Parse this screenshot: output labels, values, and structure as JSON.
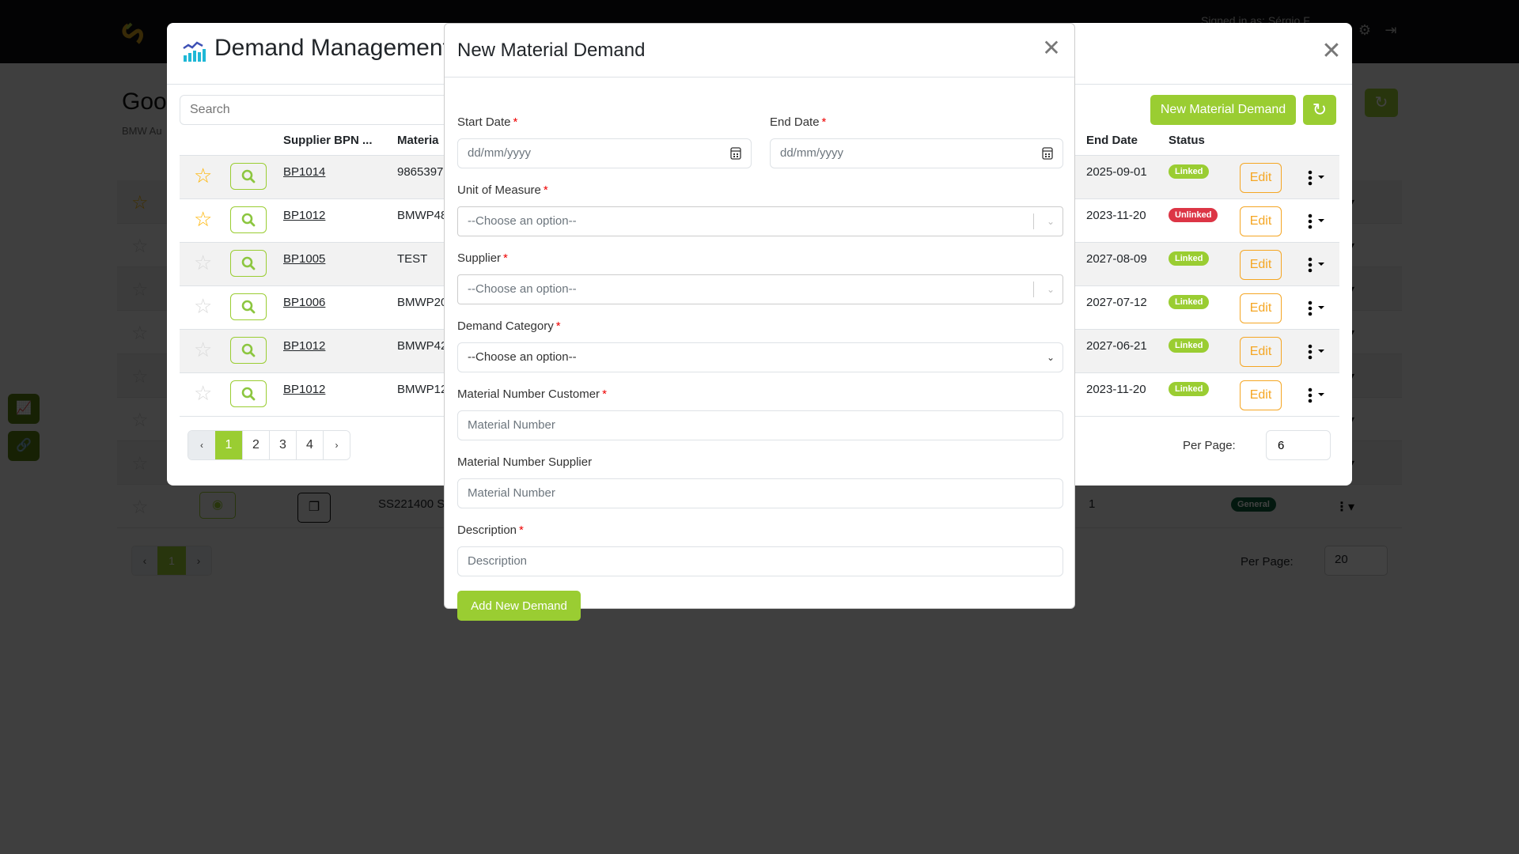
{
  "topbar": {
    "signed_in": "Signed in as: Sérgio F",
    "icons": [
      "logo-icon",
      "gear-icon",
      "logout-icon"
    ]
  },
  "background_page": {
    "title": "Goo",
    "subtitle": "BMW Au",
    "last_row": {
      "material": "SS221400 S",
      "quantity": "1",
      "category": "General"
    },
    "pagination": {
      "prev": "‹",
      "current": "1",
      "next": "›"
    },
    "per_page_label": "Per Page:",
    "per_page_value": "20"
  },
  "demand_modal": {
    "title": "Demand Management",
    "search_placeholder": "Search",
    "new_button": "New Material Demand",
    "columns": {
      "supplier_bpn": "Supplier BPN ...",
      "material": "Materia",
      "end_date": "End Date",
      "status": "Status"
    },
    "rows": [
      {
        "starred": true,
        "bpn": "BP1014",
        "material": "9865397",
        "end_date": "2025-09-01",
        "status": "Linked",
        "edit": "Edit"
      },
      {
        "starred": true,
        "bpn": "BP1012",
        "material": "BMWP48",
        "end_date": "2023-11-20",
        "status": "Unlinked",
        "edit": "Edit"
      },
      {
        "starred": false,
        "bpn": "BP1005",
        "material": "TEST",
        "end_date": "2027-08-09",
        "status": "Linked",
        "edit": "Edit"
      },
      {
        "starred": false,
        "bpn": "BP1006",
        "material": "BMWP20",
        "end_date": "2027-07-12",
        "status": "Linked",
        "edit": "Edit"
      },
      {
        "starred": false,
        "bpn": "BP1012",
        "material": "BMWP42",
        "end_date": "2027-06-21",
        "status": "Linked",
        "edit": "Edit"
      },
      {
        "starred": false,
        "bpn": "BP1012",
        "material": "BMWP12",
        "end_date": "2023-11-20",
        "status": "Linked",
        "edit": "Edit"
      }
    ],
    "pagination": {
      "prev": "‹",
      "pages": [
        "1",
        "2",
        "3",
        "4"
      ],
      "current": "1",
      "next": "›"
    },
    "per_page_label": "Per Page:",
    "per_page_value": "6",
    "colors": {
      "accent": "#9acd32",
      "linked": "#9acd32",
      "unlinked": "#dc3545",
      "edit": "#f5a623",
      "star_on": "#ffb400"
    }
  },
  "new_demand_modal": {
    "title": "New Material Demand",
    "fields": {
      "start_date": {
        "label": "Start Date",
        "required": "*",
        "placeholder": "dd/mm/yyyy"
      },
      "end_date": {
        "label": "End Date",
        "required": "*",
        "placeholder": "dd/mm/yyyy"
      },
      "unit_of_measure": {
        "label": "Unit of Measure",
        "required": "*",
        "value": "--Choose an option--"
      },
      "supplier": {
        "label": "Supplier",
        "required": "*",
        "value": "--Choose an option--"
      },
      "demand_category": {
        "label": "Demand Category",
        "required": "*",
        "value": "--Choose an option--"
      },
      "material_number_customer": {
        "label": "Material Number Customer",
        "required": "*",
        "placeholder": "Material Number"
      },
      "material_number_supplier": {
        "label": "Material Number Supplier",
        "placeholder": "Material Number"
      },
      "description": {
        "label": "Description",
        "required": "*",
        "placeholder": "Description"
      }
    },
    "submit_button": "Add New Demand"
  }
}
